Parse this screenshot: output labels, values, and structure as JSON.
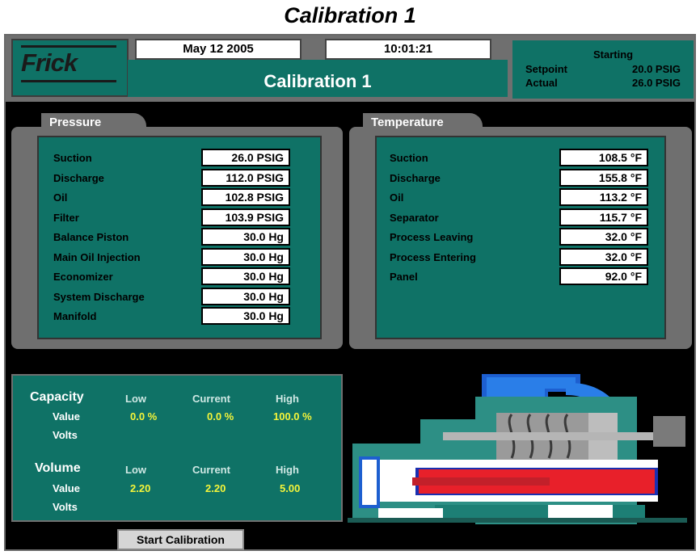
{
  "document_title": "Calibration 1",
  "header": {
    "logo": "Frick",
    "date": "May 12 2005",
    "time": "10:01:21",
    "screen_title": "Calibration 1",
    "status": "Starting",
    "setpoint_label": "Setpoint",
    "setpoint_value": "20.0 PSIG",
    "actual_label": "Actual",
    "actual_value": "26.0 PSIG"
  },
  "pressure": {
    "title": "Pressure",
    "rows": [
      {
        "label": "Suction",
        "value": "26.0 PSIG"
      },
      {
        "label": "Discharge",
        "value": "112.0 PSIG"
      },
      {
        "label": "Oil",
        "value": "102.8 PSIG"
      },
      {
        "label": "Filter",
        "value": "103.9 PSIG"
      },
      {
        "label": "Balance Piston",
        "value": "30.0 Hg"
      },
      {
        "label": "Main Oil Injection",
        "value": "30.0 Hg"
      },
      {
        "label": "Economizer",
        "value": "30.0 Hg"
      },
      {
        "label": "System Discharge",
        "value": "30.0 Hg"
      },
      {
        "label": "Manifold",
        "value": "30.0 Hg"
      }
    ]
  },
  "temperature": {
    "title": "Temperature",
    "rows": [
      {
        "label": "Suction",
        "value": "108.5 °F"
      },
      {
        "label": "Discharge",
        "value": "155.8 °F"
      },
      {
        "label": "Oil",
        "value": "113.2 °F"
      },
      {
        "label": "Separator",
        "value": "115.7 °F"
      },
      {
        "label": "Process Leaving",
        "value": "32.0 °F"
      },
      {
        "label": "Process Entering",
        "value": "32.0 °F"
      },
      {
        "label": "Panel",
        "value": "92.0 °F"
      }
    ]
  },
  "calibration": {
    "capacity": {
      "title": "Capacity",
      "col_low": "Low",
      "col_current": "Current",
      "col_high": "High",
      "value_label": "Value",
      "volts_label": "Volts",
      "low": "0.0 %",
      "current": "0.0 %",
      "high": "100.0 %"
    },
    "volume": {
      "title": "Volume",
      "col_low": "Low",
      "col_current": "Current",
      "col_high": "High",
      "value_label": "Value",
      "volts_label": "Volts",
      "low": "2.20",
      "current": "2.20",
      "high": "5.00"
    }
  },
  "start_button": "Start Calibration",
  "colors": {
    "panel_teal": "#0f7266",
    "frame_gray": "#6f6f6f",
    "value_yellow": "#f5f53a"
  }
}
